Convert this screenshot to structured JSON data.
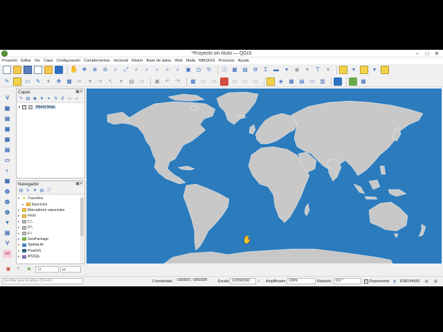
{
  "window": {
    "title": "*Proyecto sin título — QGIS",
    "controls": [
      "–",
      "□",
      "✕"
    ]
  },
  "menubar": [
    "Proyecto",
    "Editar",
    "Ver",
    "Capa",
    "Configuración",
    "Complementos",
    "Vectorial",
    "Ráster",
    "Base de datos",
    "Web",
    "Malla",
    "MMQGIS",
    "Procesos",
    "Ayuda"
  ],
  "layers_panel": {
    "title": "Capas",
    "layers": [
      {
        "name": "World Map",
        "checked": true,
        "color": "#c8c8c8"
      }
    ]
  },
  "browser_panel": {
    "title": "Navegador",
    "items": [
      {
        "label": "Favoritos",
        "icon": "star-icon",
        "expanded": true
      },
      {
        "label": "Ejercicios",
        "icon": "folder-icon",
        "expanded": false
      },
      {
        "label": "Marcadores espaciales",
        "icon": "bookmark-icon",
        "expanded": false
      },
      {
        "label": "Inicio",
        "icon": "home-folder-icon",
        "expanded": false
      },
      {
        "label": "C:\\",
        "icon": "drive-icon",
        "expanded": false
      },
      {
        "label": "D:\\",
        "icon": "drive-icon",
        "expanded": false
      },
      {
        "label": "F:\\",
        "icon": "drive-icon",
        "expanded": false
      },
      {
        "label": "GeoPackage",
        "icon": "geopackage-icon",
        "expanded": false
      },
      {
        "label": "SpatiaLite",
        "icon": "spatialite-icon",
        "expanded": false
      },
      {
        "label": "PostGIS",
        "icon": "postgis-icon",
        "expanded": false
      },
      {
        "label": "MSSQL",
        "icon": "mssql-icon",
        "expanded": false
      }
    ]
  },
  "bottom_toolbar": {
    "size_value": "12",
    "unit": "px"
  },
  "statusbar": {
    "locator_placeholder": "Escriba para localizar (Ctrl+K)",
    "coord_label": "Coordenada",
    "coord_value": "-1930557,-1892209",
    "scale_label": "Escala",
    "scale_value": "120592360",
    "magnifier_label": "Amplificador",
    "magnifier_value": "100%",
    "rotation_label": "Rotación",
    "rotation_value": "0,0 °",
    "render_label": "Representar",
    "render_checked": true,
    "crs": "ESRI:54030"
  },
  "colors": {
    "ocean": "#2b7bbd",
    "land": "#c8c8c8",
    "land_border": "#ffffff"
  }
}
